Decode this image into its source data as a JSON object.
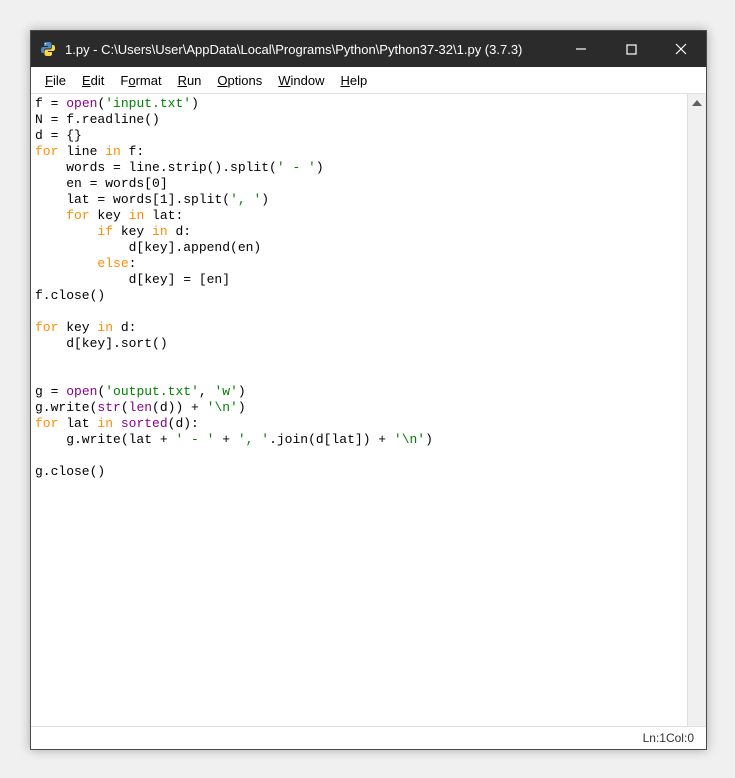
{
  "window": {
    "title": "1.py - C:\\Users\\User\\AppData\\Local\\Programs\\Python\\Python37-32\\1.py (3.7.3)"
  },
  "menu": {
    "file": "File",
    "edit": "Edit",
    "format": "Format",
    "run": "Run",
    "options": "Options",
    "window": "Window",
    "help": "Help"
  },
  "code": {
    "lines": [
      [
        {
          "t": "f = ",
          "c": ""
        },
        {
          "t": "open",
          "c": "bi"
        },
        {
          "t": "(",
          "c": ""
        },
        {
          "t": "'input.txt'",
          "c": "str"
        },
        {
          "t": ")",
          "c": ""
        }
      ],
      [
        {
          "t": "N = f.readline()",
          "c": ""
        }
      ],
      [
        {
          "t": "d = {}",
          "c": ""
        }
      ],
      [
        {
          "t": "for",
          "c": "kw"
        },
        {
          "t": " line ",
          "c": ""
        },
        {
          "t": "in",
          "c": "kw"
        },
        {
          "t": " f:",
          "c": ""
        }
      ],
      [
        {
          "t": "    words = line.strip().split(",
          "c": ""
        },
        {
          "t": "' - '",
          "c": "str"
        },
        {
          "t": ")",
          "c": ""
        }
      ],
      [
        {
          "t": "    en = words[",
          "c": ""
        },
        {
          "t": "0",
          "c": "num"
        },
        {
          "t": "]",
          "c": ""
        }
      ],
      [
        {
          "t": "    lat = words[",
          "c": ""
        },
        {
          "t": "1",
          "c": "num"
        },
        {
          "t": "].split(",
          "c": ""
        },
        {
          "t": "', '",
          "c": "str"
        },
        {
          "t": ")",
          "c": ""
        }
      ],
      [
        {
          "t": "    ",
          "c": ""
        },
        {
          "t": "for",
          "c": "kw"
        },
        {
          "t": " key ",
          "c": ""
        },
        {
          "t": "in",
          "c": "kw"
        },
        {
          "t": " lat:",
          "c": ""
        }
      ],
      [
        {
          "t": "        ",
          "c": ""
        },
        {
          "t": "if",
          "c": "kw"
        },
        {
          "t": " key ",
          "c": ""
        },
        {
          "t": "in",
          "c": "kw"
        },
        {
          "t": " d:",
          "c": ""
        }
      ],
      [
        {
          "t": "            d[key].append(en)",
          "c": ""
        }
      ],
      [
        {
          "t": "        ",
          "c": ""
        },
        {
          "t": "else",
          "c": "kw"
        },
        {
          "t": ":",
          "c": ""
        }
      ],
      [
        {
          "t": "            d[key] = [en]",
          "c": ""
        }
      ],
      [
        {
          "t": "f.close()",
          "c": ""
        }
      ],
      [
        {
          "t": "",
          "c": ""
        }
      ],
      [
        {
          "t": "for",
          "c": "kw"
        },
        {
          "t": " key ",
          "c": ""
        },
        {
          "t": "in",
          "c": "kw"
        },
        {
          "t": " d:",
          "c": ""
        }
      ],
      [
        {
          "t": "    d[key].sort()",
          "c": ""
        }
      ],
      [
        {
          "t": "",
          "c": ""
        }
      ],
      [
        {
          "t": "",
          "c": ""
        }
      ],
      [
        {
          "t": "g = ",
          "c": ""
        },
        {
          "t": "open",
          "c": "bi"
        },
        {
          "t": "(",
          "c": ""
        },
        {
          "t": "'output.txt'",
          "c": "str"
        },
        {
          "t": ", ",
          "c": ""
        },
        {
          "t": "'w'",
          "c": "str"
        },
        {
          "t": ")",
          "c": ""
        }
      ],
      [
        {
          "t": "g.write(",
          "c": ""
        },
        {
          "t": "str",
          "c": "bi"
        },
        {
          "t": "(",
          "c": ""
        },
        {
          "t": "len",
          "c": "bi"
        },
        {
          "t": "(d)) + ",
          "c": ""
        },
        {
          "t": "'\\n'",
          "c": "str"
        },
        {
          "t": ")",
          "c": ""
        }
      ],
      [
        {
          "t": "for",
          "c": "kw"
        },
        {
          "t": " lat ",
          "c": ""
        },
        {
          "t": "in",
          "c": "kw"
        },
        {
          "t": " ",
          "c": ""
        },
        {
          "t": "sorted",
          "c": "bi"
        },
        {
          "t": "(d):",
          "c": ""
        }
      ],
      [
        {
          "t": "    g.write(lat + ",
          "c": ""
        },
        {
          "t": "' - '",
          "c": "str"
        },
        {
          "t": " + ",
          "c": ""
        },
        {
          "t": "', '",
          "c": "str"
        },
        {
          "t": ".join(d[lat]) + ",
          "c": ""
        },
        {
          "t": "'\\n'",
          "c": "str"
        },
        {
          "t": ")",
          "c": ""
        }
      ],
      [
        {
          "t": "",
          "c": ""
        }
      ],
      [
        {
          "t": "g.close()",
          "c": ""
        }
      ]
    ]
  },
  "status": {
    "ln_label": "Ln: ",
    "ln_value": "1",
    "col_label": "  Col: ",
    "col_value": "0"
  }
}
